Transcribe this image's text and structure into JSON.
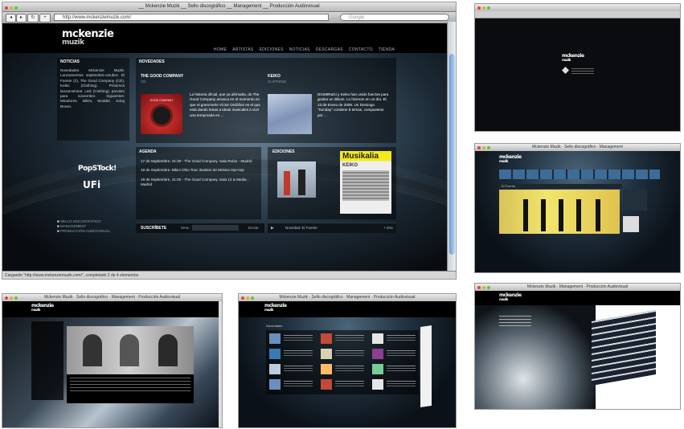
{
  "main": {
    "window_title": "__ Mckenzie Muzik __ Sello discográfico __ Management __ Producción Audiovisual",
    "url": "http://www.mckenziemuzik.com/",
    "search_placeholder": "Google",
    "status": "Cargando \"http://www.mckenziemuzik.com/\", completado 2 de 4 elementos",
    "nav_back": "◂",
    "nav_fwd": "▸",
    "nav_reload": "↻",
    "nav_add": "+"
  },
  "site": {
    "logo_line1": "mckenzie",
    "logo_line2": "muzik",
    "nav": [
      "HOME",
      "ARTISTAS",
      "EDICIONES",
      "NOTICIAS",
      "DESCARGAS",
      "CONTACTO",
      "TIENDA"
    ],
    "noticias": {
      "header": "NOTICIAS",
      "body": "Novedades Mckenzie Muzik: Lanzamientos septiembre-octubre: El Fuente (2), The Good Company (CD), Keiko (Clothing). Próximos lanzamientos: Link (Clothing), previsto para noviembre. Siguientes: Miradores, Bikini, Moddel, Joing Brown."
    },
    "novedades": {
      "header": "NOVEDADES",
      "item1_title": "THE GOOD COMPANY",
      "item1_sub": "CD",
      "item1_text": "La historia oficial, que ya afirmaba, de The Good Company arranca en el momento en que el grammerle Víctor Ordóñez es el que está dando letras a ideas musicales a vivir una temporada en ...",
      "item2_title": "KEIKO",
      "item2_sub": "CLOTHING",
      "item2_text": "DrUMtRaGi y Keiko han unido fuerzas para grabar un álbum. Lo hicieron en un día. El 13 de Enero de 2008. Un Domingo \"Sunday\" contiene 8 temas, compuestos por ...",
      "cover1_label": "GOOD COMPANY"
    },
    "agenda": {
      "header": "AGENDA",
      "events": [
        "17 de Septiembre, 21:30 - The Good Company. Sala Rubio - Madrid",
        "18 de Septiembre: Bikini Ohio Tour. Bastion de Música Hip-Hop",
        "19 de Septiembre, 21:00 - The Good Company. Sala 12 & Media - Madrid"
      ]
    },
    "ediciones": {
      "header": "EDICIONES",
      "cover2_label": "Musikalia",
      "cover2_sub": "KEIKO",
      "player_label": "Novedad: El Fuente",
      "player_controls": "+ Dsc"
    },
    "logos": {
      "popstock": "PopSTock!",
      "ufi": "UFi"
    },
    "sidelinks": [
      "SELLO DISCOGRÁFICO",
      "MANAGEMENT",
      "PRODUCCIÓN AUDIOVISUAL"
    ],
    "subscribe": {
      "label": "SUSCRÍBETE",
      "mail_label": "MAIL:",
      "button": "Enviar"
    }
  },
  "thumbs": {
    "tab1": "Mckenzie Muzik",
    "tab2": "Sello discográfico",
    "tab3": "Management",
    "tab4": "Producción Audiovisual",
    "t2_player_title": "El Fuente",
    "t6_subheader": "Novedades"
  }
}
